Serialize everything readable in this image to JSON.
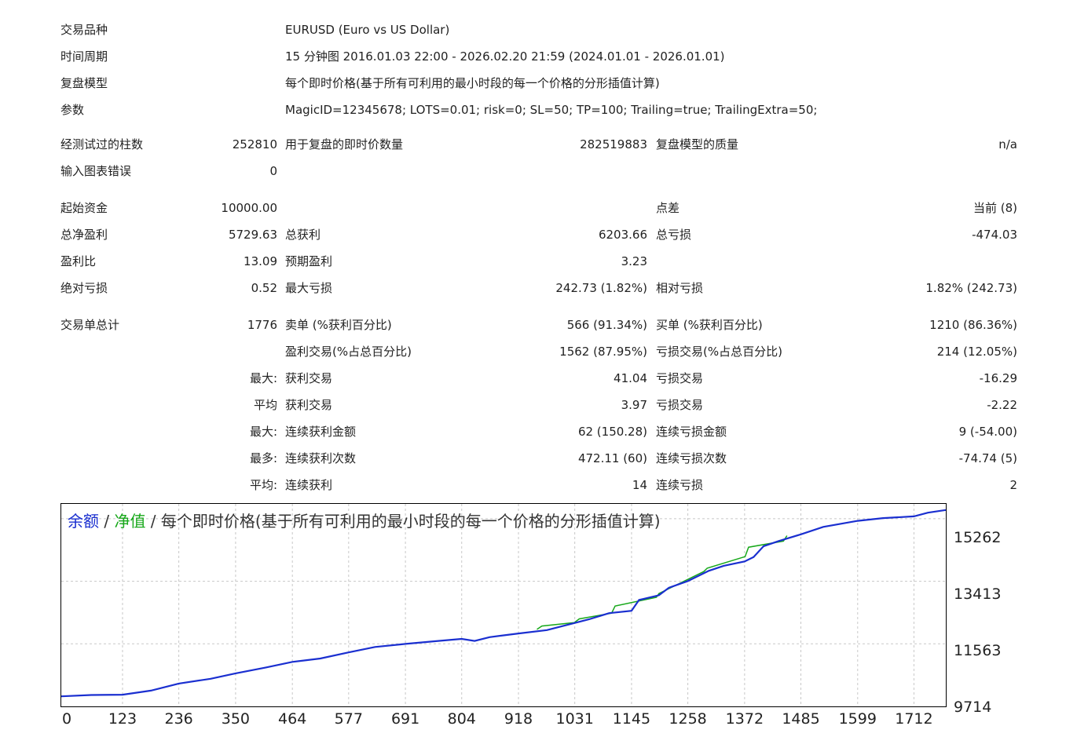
{
  "report": {
    "symbol_label": "交易品种",
    "symbol_value": "EURUSD (Euro vs US Dollar)",
    "period_label": "时间周期",
    "period_value": "15 分钟图 2016.01.03 22:00 - 2026.02.20 21:59 (2024.01.01 - 2026.01.01)",
    "model_label": "复盘模型",
    "model_value": "每个即时价格(基于所有可利用的最小时段的每一个价格的分形插值计算)",
    "params_label": "参数",
    "params_value": "MagicID=12345678; LOTS=0.01; risk=0; SL=50; TP=100; Trailing=true; TrailingExtra=50;",
    "bars_label": "经测试过的柱数",
    "bars_value": "252810",
    "ticks_label": "用于复盘的即时价数量",
    "ticks_value": "282519883",
    "quality_label": "复盘模型的质量",
    "quality_value": "n/a",
    "errors_label": "输入图表错误",
    "errors_value": "0",
    "deposit_label": "起始资金",
    "deposit_value": "10000.00",
    "spread_label": "点差",
    "spread_value": "当前 (8)",
    "net_label": "总净盈利",
    "net_value": "5729.63",
    "gross_profit_label": "总获利",
    "gross_profit_value": "6203.66",
    "gross_loss_label": "总亏损",
    "gross_loss_value": "-474.03",
    "pf_label": "盈利比",
    "pf_value": "13.09",
    "expected_label": "预期盈利",
    "expected_value": "3.23",
    "abs_dd_label": "绝对亏损",
    "abs_dd_value": "0.52",
    "max_dd_label": "最大亏损",
    "max_dd_value": "242.73 (1.82%)",
    "rel_dd_label": "相对亏损",
    "rel_dd_value": "1.82% (242.73)",
    "total_trades_label": "交易单总计",
    "total_trades_value": "1776",
    "short_label": "卖单 (%获利百分比)",
    "short_value": "566 (91.34%)",
    "long_label": "买单 (%获利百分比)",
    "long_value": "1210 (86.36%)",
    "profit_trades_label": "盈利交易(%占总百分比)",
    "profit_trades_value": "1562 (87.95%)",
    "loss_trades_label": "亏损交易(%占总百分比)",
    "loss_trades_value": "214 (12.05%)",
    "largest_prefix": "最大:",
    "largest_profit_label": "获利交易",
    "largest_profit_value": "41.04",
    "largest_loss_label": "亏损交易",
    "largest_loss_value": "-16.29",
    "average_prefix": "平均",
    "average_profit_label": "获利交易",
    "average_profit_value": "3.97",
    "average_loss_label": "亏损交易",
    "average_loss_value": "-2.22",
    "max_consec_prefix": "最大:",
    "max_consec_wins_label": "连续获利金额",
    "max_consec_wins_value": "62 (150.28)",
    "max_consec_losses_label": "连续亏损金额",
    "max_consec_losses_value": "9 (-54.00)",
    "maximal_prefix": "最多:",
    "maximal_profit_label": "连续获利次数",
    "maximal_profit_value": "472.11 (60)",
    "maximal_loss_label": "连续亏损次数",
    "maximal_loss_value": "-74.74 (5)",
    "avg_consec_prefix": "平均:",
    "avg_consec_wins_label": "连续获利",
    "avg_consec_wins_value": "14",
    "avg_consec_losses_label": "连续亏损",
    "avg_consec_losses_value": "2"
  },
  "chart_title": {
    "balance": "余额",
    "sep1": " / ",
    "equity": "净值",
    "sep2": " / ",
    "model": "每个即时价格(基于所有可利用的最小时段的每一个价格的分形插值计算)"
  },
  "colors": {
    "balance": "#1a2fd0",
    "equity": "#17a81a",
    "grid": "#c8c8c8"
  },
  "chart_data": {
    "type": "line",
    "title": "余额 / 净值 / 每个即时价格(基于所有可利用的最小时段的每一个价格的分形插值计算)",
    "xlabel": "",
    "ylabel": "",
    "x_ticks": [
      "0",
      "123",
      "236",
      "350",
      "464",
      "577",
      "691",
      "804",
      "918",
      "1031",
      "1145",
      "1258",
      "1372",
      "1485",
      "1599",
      "1712"
    ],
    "y_ticks": [
      "15262",
      "13413",
      "11563",
      "9714"
    ],
    "xlim": [
      0,
      1776
    ],
    "ylim": [
      9714,
      15700
    ],
    "grid": true,
    "series": [
      {
        "name": "余额",
        "x": [
          0,
          60,
          123,
          180,
          236,
          300,
          350,
          410,
          464,
          520,
          577,
          630,
          691,
          750,
          804,
          830,
          860,
          918,
          975,
          1031,
          1060,
          1100,
          1145,
          1160,
          1200,
          1220,
          1258,
          1300,
          1330,
          1372,
          1390,
          1410,
          1440,
          1485,
          1530,
          1599,
          1650,
          1712,
          1740,
          1776
        ],
        "y": [
          10010,
          10050,
          10060,
          10180,
          10390,
          10530,
          10690,
          10860,
          11030,
          11130,
          11310,
          11470,
          11560,
          11640,
          11710,
          11650,
          11760,
          11870,
          11970,
          12180,
          12290,
          12470,
          12540,
          12860,
          13000,
          13220,
          13420,
          13720,
          13870,
          14000,
          14130,
          14450,
          14600,
          14800,
          15020,
          15200,
          15280,
          15330,
          15440,
          15520
        ]
      },
      {
        "name": "净值",
        "x": [
          955,
          965,
          1030,
          1040,
          1105,
          1112,
          1195,
          1200,
          1290,
          1297,
          1373,
          1380,
          1450,
          1457
        ],
        "y": [
          11990,
          12090,
          12190,
          12300,
          12470,
          12680,
          12940,
          13050,
          13700,
          13800,
          14140,
          14420,
          14600,
          14760
        ]
      }
    ]
  }
}
